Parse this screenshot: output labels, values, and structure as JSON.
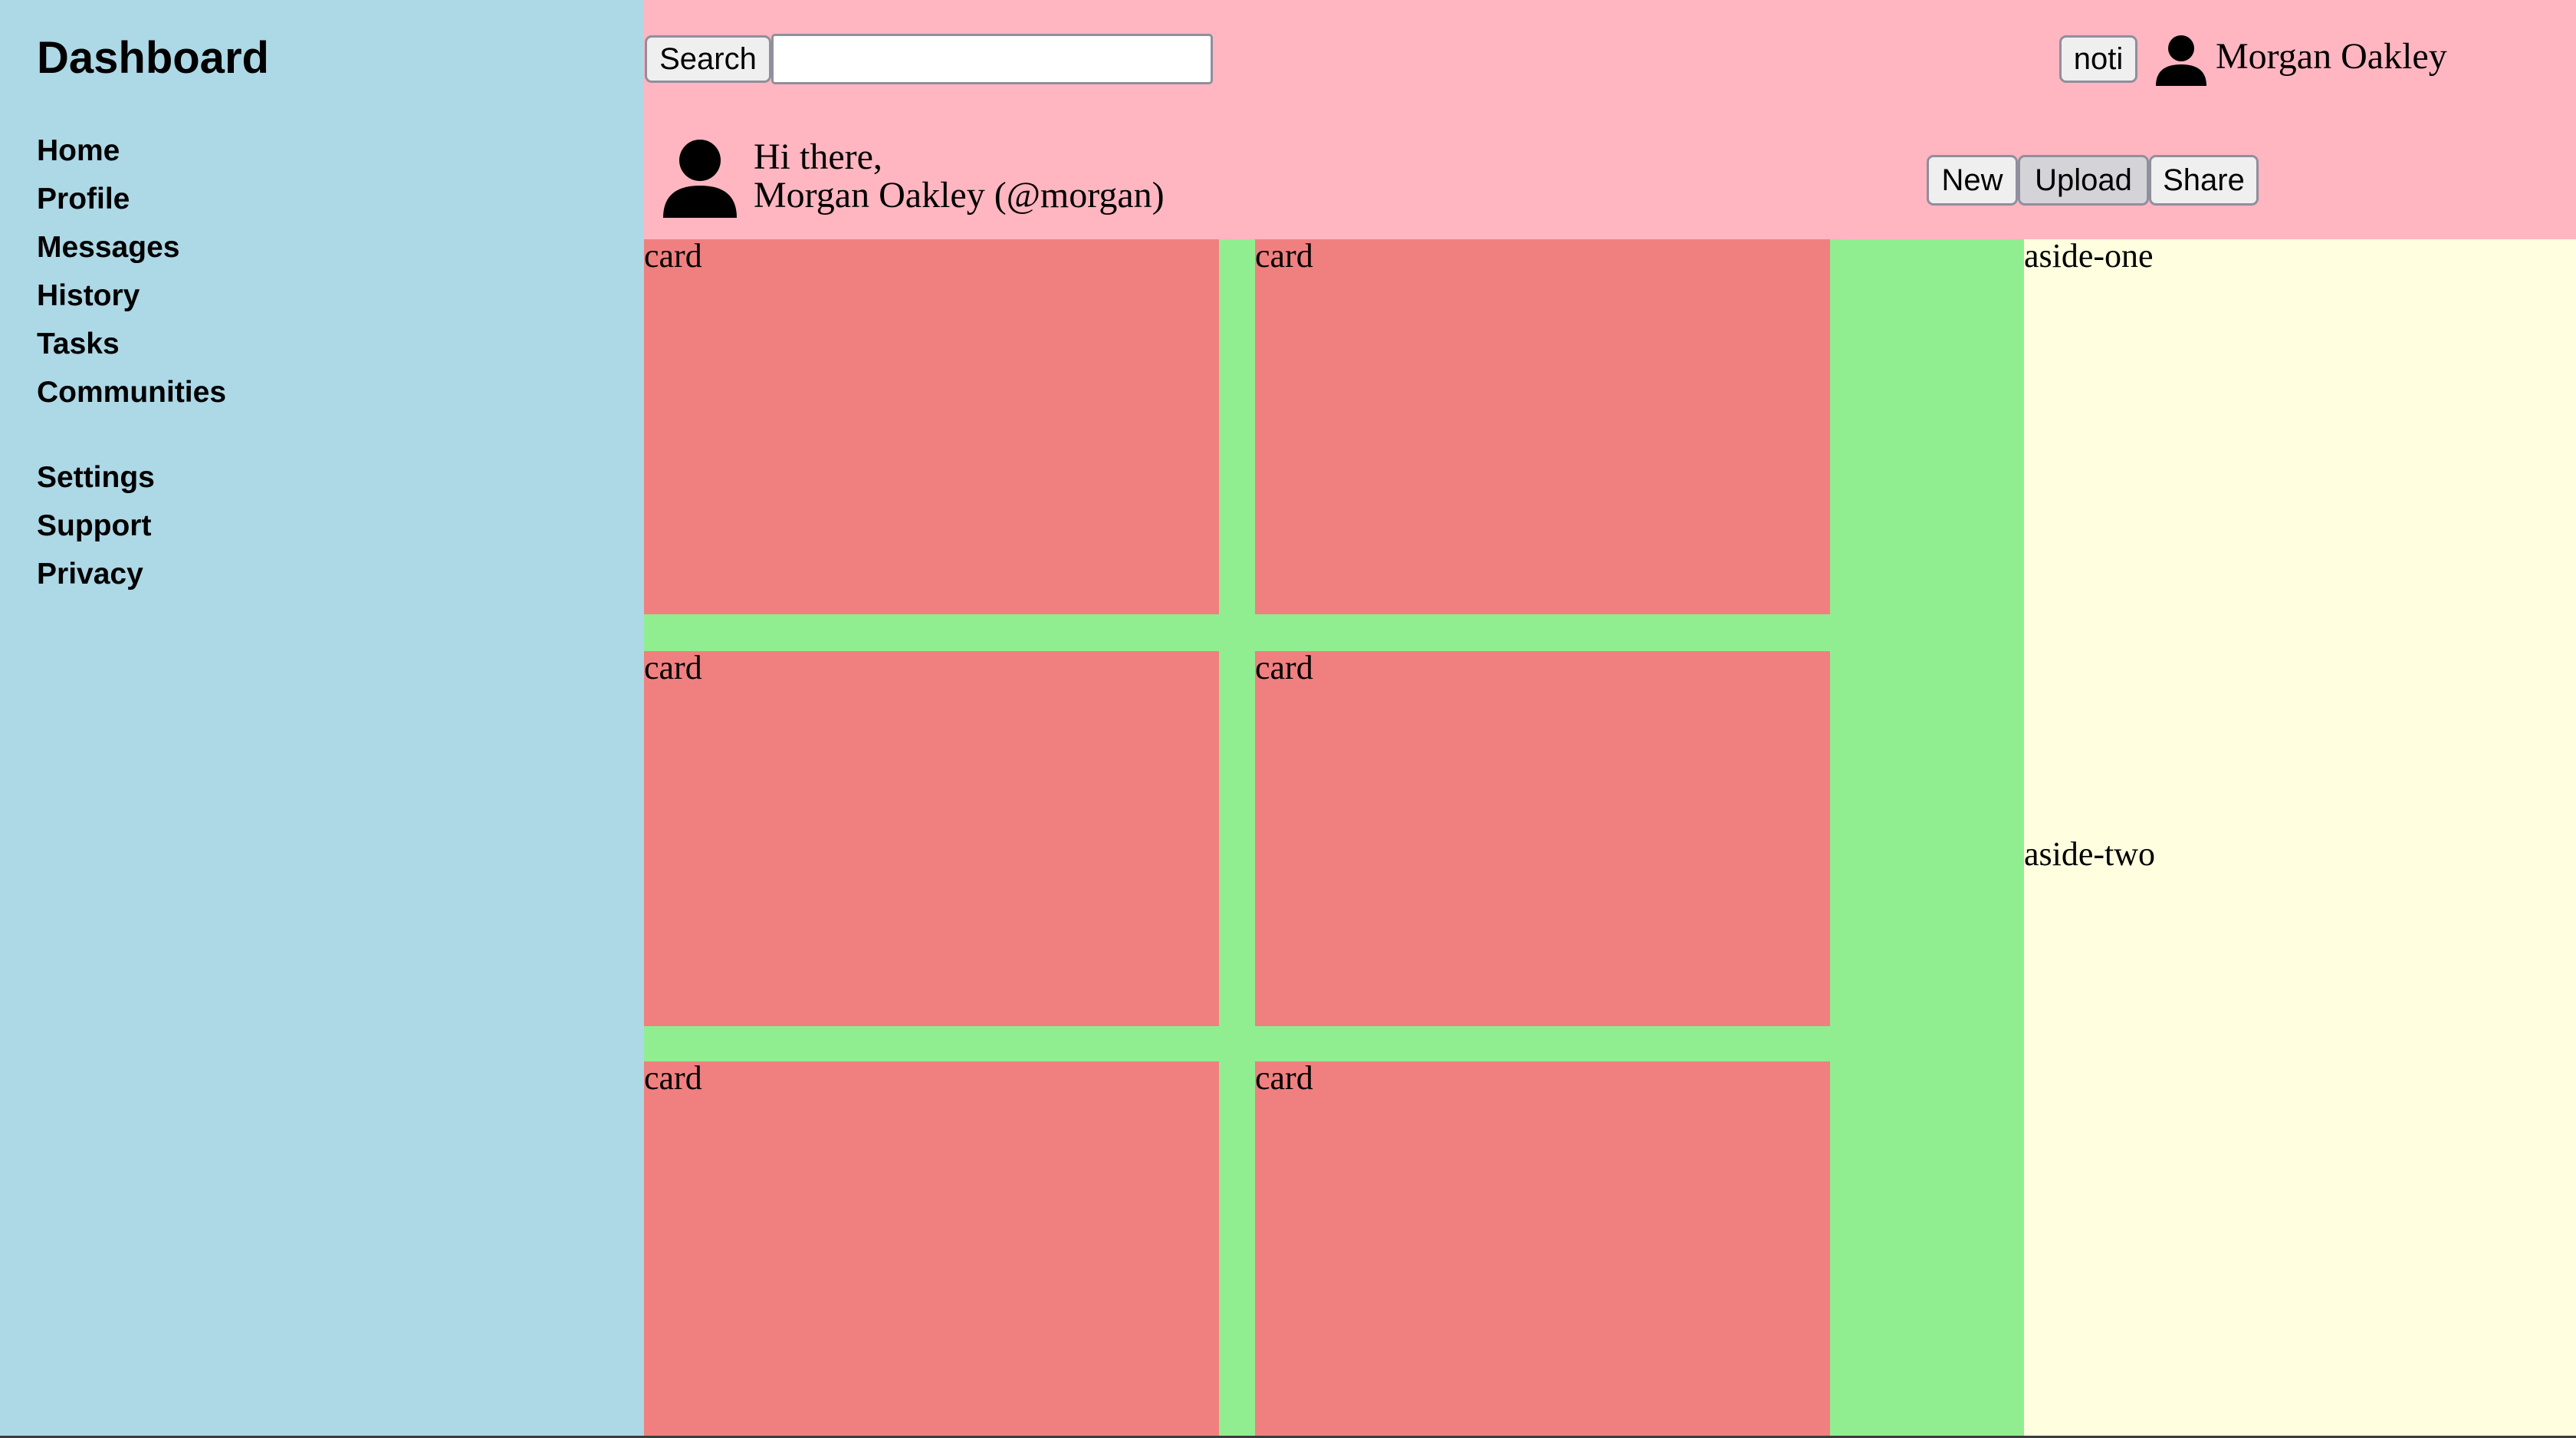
{
  "sidebar": {
    "title": "Dashboard",
    "nav": [
      "Home",
      "Profile",
      "Messages",
      "History",
      "Tasks",
      "Communities"
    ],
    "secondary": [
      "Settings",
      "Support",
      "Privacy"
    ]
  },
  "header": {
    "search_button": "Search",
    "search_value": "",
    "search_placeholder": "",
    "notification_button": "noti",
    "user_name": "Morgan Oakley",
    "greeting_line1": "Hi there,",
    "greeting_line2": "Morgan Oakley (@morgan)",
    "actions": [
      "New",
      "Upload",
      "Share"
    ],
    "pressed_action": "Upload"
  },
  "cards": [
    "card",
    "card",
    "card",
    "card",
    "card",
    "card"
  ],
  "aside": {
    "one": "aside-one",
    "two": "aside-two"
  },
  "colors": {
    "sidebar": "#add8e6",
    "header": "#ffb6c1",
    "main": "#90ee90",
    "card": "#f08080",
    "aside": "#ffffe0"
  },
  "icons": {
    "header_avatar": "user-icon",
    "greeting_avatar": "user-icon"
  }
}
